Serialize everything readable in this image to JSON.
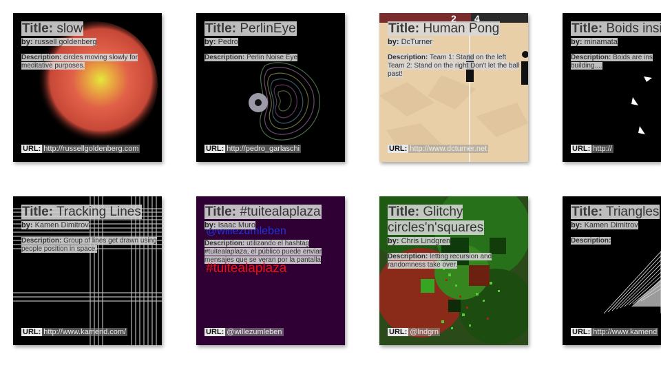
{
  "labels": {
    "title": "Title:",
    "by": "by:",
    "description": "Description:",
    "url": "URL:"
  },
  "cards": [
    {
      "title": "slow",
      "author": "russell goldenberg",
      "description": "circles moving slowly for meditative purposes.",
      "url": "http://russellgoldenberg.com"
    },
    {
      "title": "PerlinEye",
      "author": "Pedro",
      "description": "Perlin Noise Eye",
      "url": "http://pedro_garlaschi"
    },
    {
      "title": "Human Pong",
      "author": "DcTurner",
      "description": "Team 1: Stand on the left Team 2: Stand on the right Don't let the ball past!",
      "url": "http://www.dcturner.net",
      "score": [
        "2",
        "4"
      ]
    },
    {
      "title": "Boids insid",
      "author": "minamata",
      "description": "Boids are ins building....",
      "url": "http://"
    },
    {
      "title": "Tracking Lines",
      "author": "Kamen Dimitrov",
      "description": "Group of lines get drawn using people position in space.",
      "url": "http://www.kamend.com/"
    },
    {
      "title": "#tuitealaplaza",
      "author": "Isaac Muro",
      "description": "utilizando el hashtag #tuitealaplaza, el público puede enviar mensajes que se veran por la pantalla",
      "url": "@willezumleben",
      "overlay_blue": "@willezumleben",
      "overlay_red": "#tuitealaplaza"
    },
    {
      "title": "Glitchy circles'n'squares",
      "author": "Chris Lindgren",
      "description": "letting recursion and randomness take over.",
      "url": "@lndgrn"
    },
    {
      "title": "Triangles",
      "author": "Kamen Dimitrov",
      "description": "",
      "url": "http://www.kamend"
    }
  ]
}
